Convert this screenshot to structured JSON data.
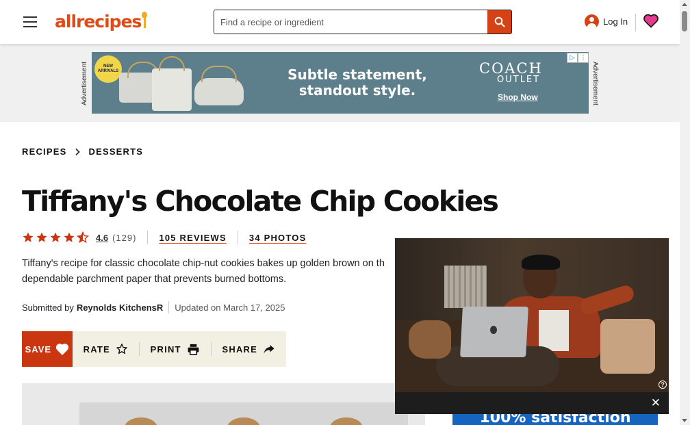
{
  "header": {
    "logo_text": "allrecipes",
    "search_placeholder": "Find a recipe or ingredient",
    "login_label": "Log In",
    "brand_color": "#e04a16"
  },
  "ad": {
    "label": "Advertisement",
    "badge": "NEW ARRIVALS",
    "headline_line1": "Subtle statement,",
    "headline_line2": "standout style.",
    "brand": "COACH",
    "sub": "OUTLET",
    "cta": "Shop Now"
  },
  "breadcrumb": {
    "items": [
      "RECIPES",
      "DESSERTS"
    ]
  },
  "recipe": {
    "title": "Tiffany's Chocolate Chip Cookies",
    "rating_value": "4.6",
    "rating_count": "(129)",
    "stars": 4.5,
    "reviews_link": "105 REVIEWS",
    "photos_link": "34 PHOTOS",
    "description_line1": "Tiffany's recipe for classic chocolate chip-nut cookies bakes up golden brown on th",
    "description_line2": "dependable parchment paper that prevents burned bottoms.",
    "submitted_prefix": "Submitted by",
    "author": "Reynolds KitchensR",
    "updated": "Updated on March 17, 2025"
  },
  "actions": {
    "save": "SAVE",
    "rate": "RATE",
    "print": "PRINT",
    "share": "SHARE"
  },
  "promo": {
    "text": "100% satisfaction"
  },
  "video": {
    "help": "?",
    "close": "✕"
  }
}
